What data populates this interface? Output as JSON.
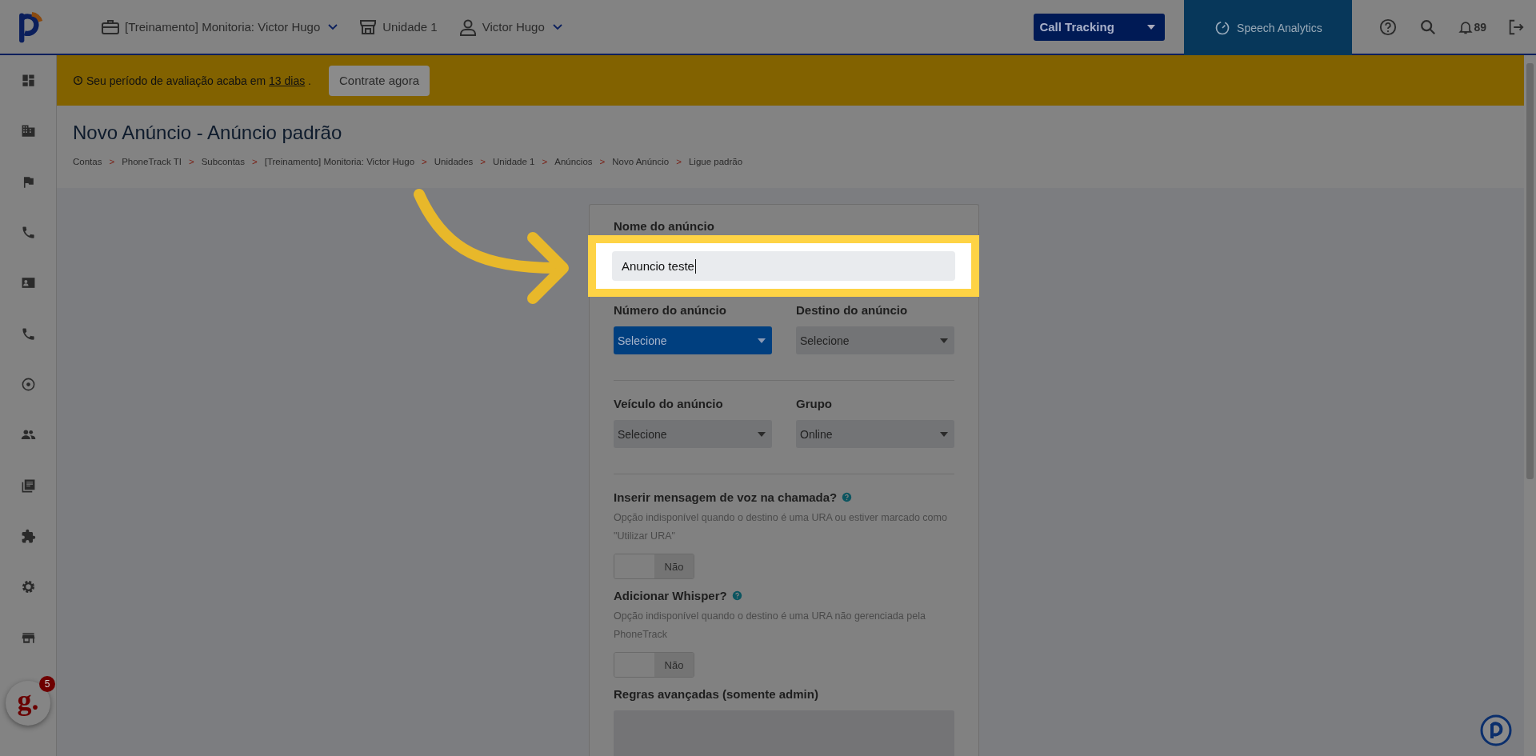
{
  "topbar": {
    "account": "[Treinamento] Monitoria: Victor Hugo",
    "unit": "Unidade 1",
    "user": "Victor Hugo",
    "product_select": "Call Tracking",
    "speech_tab": "Speech Analytics",
    "notification_count": "89"
  },
  "sidebar": {
    "items": [
      {
        "kind": "dashboard"
      },
      {
        "kind": "building"
      },
      {
        "kind": "flag"
      },
      {
        "kind": "phone"
      },
      {
        "kind": "contact"
      },
      {
        "kind": "phone"
      },
      {
        "kind": "radar"
      },
      {
        "kind": "people"
      },
      {
        "kind": "library"
      },
      {
        "kind": "puzzle"
      },
      {
        "kind": "gear"
      },
      {
        "kind": "store"
      }
    ]
  },
  "banner": {
    "text": "Seu período de avaliação acaba em",
    "link": "13 dias",
    "end": ".",
    "button": "Contrate agora"
  },
  "page": {
    "title": "Novo Anúncio - Anúncio padrão",
    "breadcrumb": [
      {
        "text": "Contas"
      },
      {
        "separator": ">",
        "text": "PhoneTrack TI"
      },
      {
        "separator": ">",
        "text": "Subcontas"
      },
      {
        "separator": ">",
        "text": "[Treinamento] Monitoria: Victor Hugo"
      },
      {
        "separator": ">",
        "text": "Unidades"
      },
      {
        "separator": ">",
        "text": "Unidade 1"
      },
      {
        "separator": ">",
        "text": "Anúncios"
      },
      {
        "separator": ">",
        "text": "Novo Anúncio"
      },
      {
        "separator": ">",
        "text": "Ligue padrão"
      }
    ]
  },
  "form": {
    "name_label": "Nome do anúncio",
    "name_value": "Anuncio teste",
    "selects": [
      {
        "label": "Número do anúncio",
        "value": "Selecione",
        "focused": true
      },
      {
        "label": "Destino do anúncio",
        "value": "Selecione",
        "focused": false
      },
      {
        "label": "Veículo do anúncio",
        "value": "Selecione",
        "focused": false
      },
      {
        "label": "Grupo",
        "value": "Online",
        "focused": false
      }
    ],
    "toggles": [
      {
        "label": "Inserir mensagem de voz na chamada?",
        "note": "Opção indisponível quando o destino é uma URA ou estiver marcado como \"Utilizar URA\"",
        "state": "Não",
        "on": false
      },
      {
        "label": "Adicionar Whisper?",
        "note": "Opção indisponível quando o destino é uma URA não gerenciada pela PhoneTrack",
        "state": "Não",
        "on": false
      }
    ],
    "advanced_label": "Regras avançadas (somente admin)"
  },
  "chat_widget": {
    "logo_text": "g.",
    "badge": "5"
  }
}
